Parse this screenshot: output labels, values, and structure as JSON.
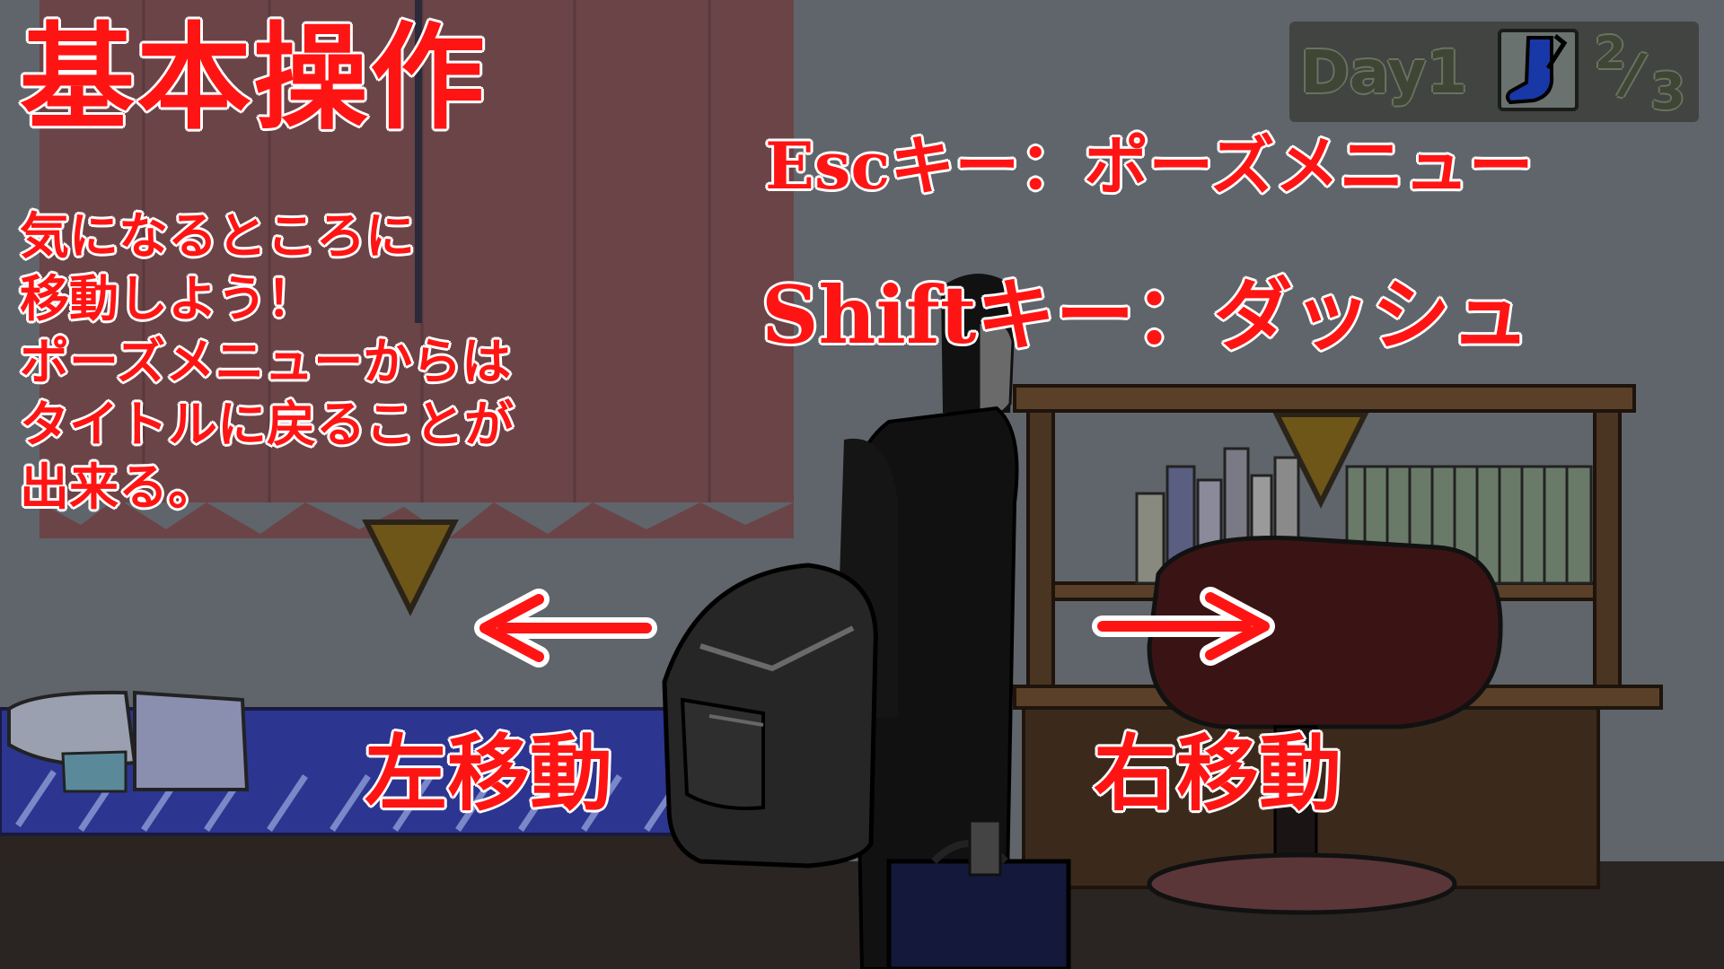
{
  "title": "基本操作",
  "help_lines": [
    "気になるところに",
    "移動しよう！",
    "ポーズメニューからは",
    "タイトルに戻ることが",
    "出来る。"
  ],
  "esc_hint": "Escキー：ポーズメニュー",
  "shift_hint": "Shiftキー：ダッシュ",
  "move_left": "左移動",
  "move_right": "右移動",
  "hud": {
    "day": "Day1",
    "collected": "2",
    "slash": "/",
    "total": "3",
    "item_icon": "sock-icon"
  },
  "colors": {
    "hint_text": "#ff1414",
    "hint_outline": "#ffffff",
    "marker": "#6e5518",
    "wall": "#5f656a",
    "curtain": "#6b4448",
    "bed_blanket": "#2c3590",
    "desk": "#3b2a1c"
  }
}
